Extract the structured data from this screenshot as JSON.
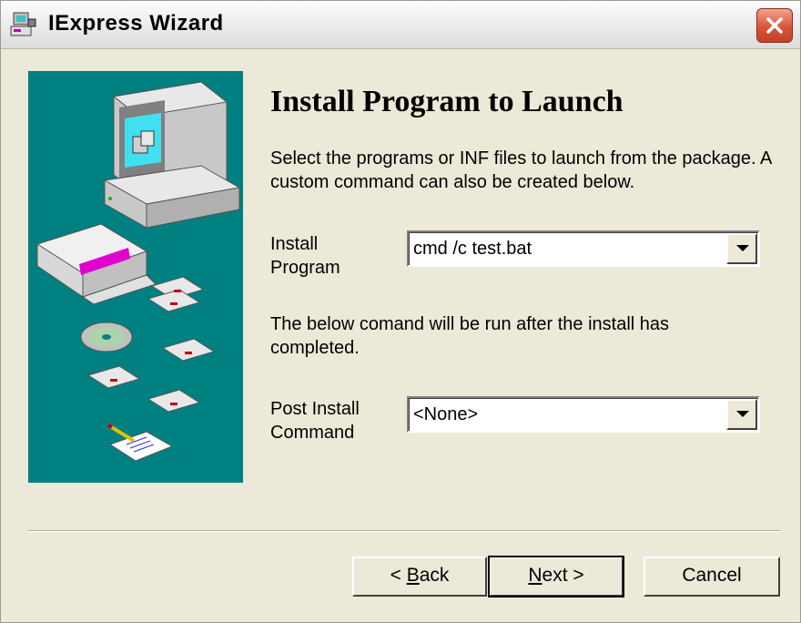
{
  "window": {
    "title": "IExpress Wizard",
    "close_icon": "close-icon"
  },
  "page": {
    "heading": "Install Program to Launch",
    "description": "Select the programs or INF files to launch from the package.  A custom command can also be created below."
  },
  "install_program": {
    "label_line1": "Install",
    "label_line2": "Program",
    "value": "cmd /c test.bat"
  },
  "post_install_note": "The below comand will be run after the install has completed.",
  "post_install_command": {
    "label_line1": "Post Install",
    "label_line2": "Command",
    "value": "<None>"
  },
  "buttons": {
    "back_prefix": "< ",
    "back_mnemonic": "B",
    "back_rest": "ack",
    "next_mnemonic": "N",
    "next_rest": "ext >",
    "cancel": "Cancel"
  }
}
